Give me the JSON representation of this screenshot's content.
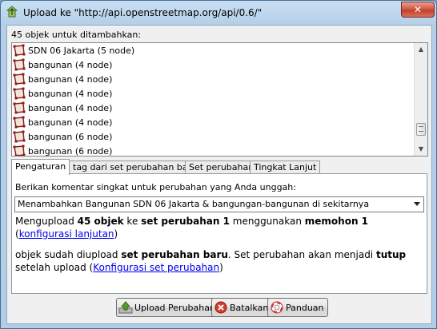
{
  "window": {
    "title": "Upload ke \"http://api.openstreetmap.org/api/0.6/\"",
    "close_glyph": "✕"
  },
  "objects": {
    "label": "45 objek untuk ditambahkan:",
    "items": [
      {
        "label": "SDN 06 Jakarta (5 node)",
        "icon": "way-icon"
      },
      {
        "label": "bangunan (4 node)",
        "icon": "way-icon"
      },
      {
        "label": "bangunan (4 node)",
        "icon": "way-icon"
      },
      {
        "label": "bangunan (4 node)",
        "icon": "way-icon"
      },
      {
        "label": "bangunan (4 node)",
        "icon": "way-icon"
      },
      {
        "label": "bangunan (4 node)",
        "icon": "way-icon"
      },
      {
        "label": "bangunan (6 node)",
        "icon": "way-icon"
      },
      {
        "label": "bangunan (6 node)",
        "icon": "way-icon"
      }
    ]
  },
  "tabs": [
    {
      "label": "Pengaturan",
      "active": true
    },
    {
      "label": "tag dari set perubahan baru",
      "active": false
    },
    {
      "label": "Set perubahan",
      "active": false
    },
    {
      "label": "Tingkat Lanjut",
      "active": false
    }
  ],
  "settings": {
    "comment_label": "Berikan komentar singkat untuk perubahan yang Anda unggah:",
    "comment_value": "Menambahkan Bangunan SDN 06 Jakarta & bangungan-bangunan di sekitarnya",
    "info1": {
      "p1": "Mengupload ",
      "count": "45 objek",
      "p2": " ke ",
      "changeset": "set perubahan 1",
      "p3": " menggunakan ",
      "request": "memohon 1",
      "p4": " (",
      "link": "konfigurasi lanjutan",
      "p5": ")"
    },
    "info2": {
      "p1": "objek sudah diupload ",
      "new_changeset": "set perubahan baru",
      "p2": ". Set perubahan akan menjadi ",
      "closed": "tutup",
      "p3": " setelah upload (",
      "link": "Konfigurasi set perubahan",
      "p4": ")"
    }
  },
  "buttons": {
    "upload": "Upload Perubahan",
    "cancel": "Batalkan",
    "help": "Panduan"
  },
  "colors": {
    "link": "#0000ee",
    "way_icon_stroke": "#8b1a1a",
    "way_icon_fill": "#d9b38c"
  }
}
